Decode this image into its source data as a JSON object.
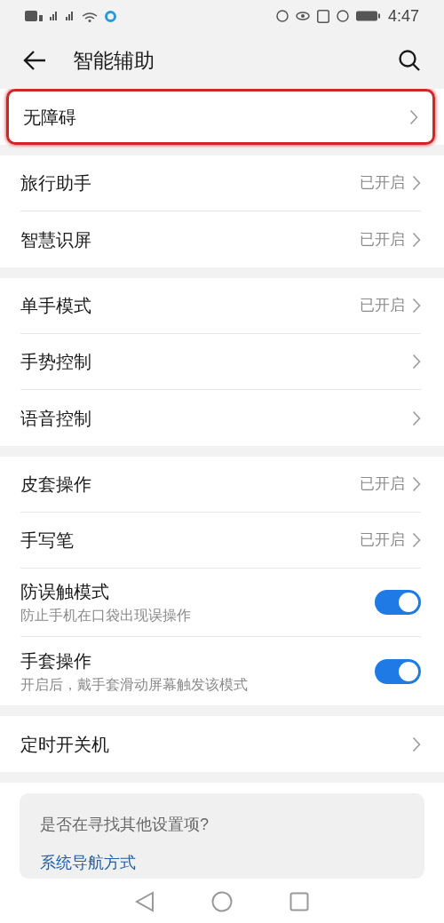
{
  "status_bar": {
    "time": "4:47"
  },
  "header": {
    "title": "智能辅助"
  },
  "groups": [
    {
      "items": [
        {
          "kind": "link",
          "label": "无障碍",
          "highlighted": true
        }
      ]
    },
    {
      "items": [
        {
          "kind": "link",
          "label": "旅行助手",
          "value": "已开启",
          "highlighted": false
        },
        {
          "kind": "link",
          "label": "智慧识屏",
          "value": "已开启",
          "highlighted": false
        }
      ]
    },
    {
      "items": [
        {
          "kind": "link",
          "label": "单手模式",
          "value": "已开启",
          "highlighted": false
        },
        {
          "kind": "link",
          "label": "手势控制",
          "highlighted": false
        },
        {
          "kind": "link",
          "label": "语音控制",
          "highlighted": false
        }
      ]
    },
    {
      "items": [
        {
          "kind": "link",
          "label": "皮套操作",
          "value": "已开启",
          "highlighted": false
        },
        {
          "kind": "link",
          "label": "手写笔",
          "value": "已开启",
          "highlighted": false
        },
        {
          "kind": "switch",
          "label": "防误触模式",
          "description": "防止手机在口袋出现误操作",
          "on": true
        },
        {
          "kind": "switch",
          "label": "手套操作",
          "description": "开启后，戴手套滑动屏幕触发该模式",
          "on": true
        }
      ]
    },
    {
      "items": [
        {
          "kind": "link",
          "label": "定时开关机",
          "highlighted": false
        }
      ]
    }
  ],
  "suggestion": {
    "title": "是否在寻找其他设置项?",
    "link": "系统导航方式"
  }
}
